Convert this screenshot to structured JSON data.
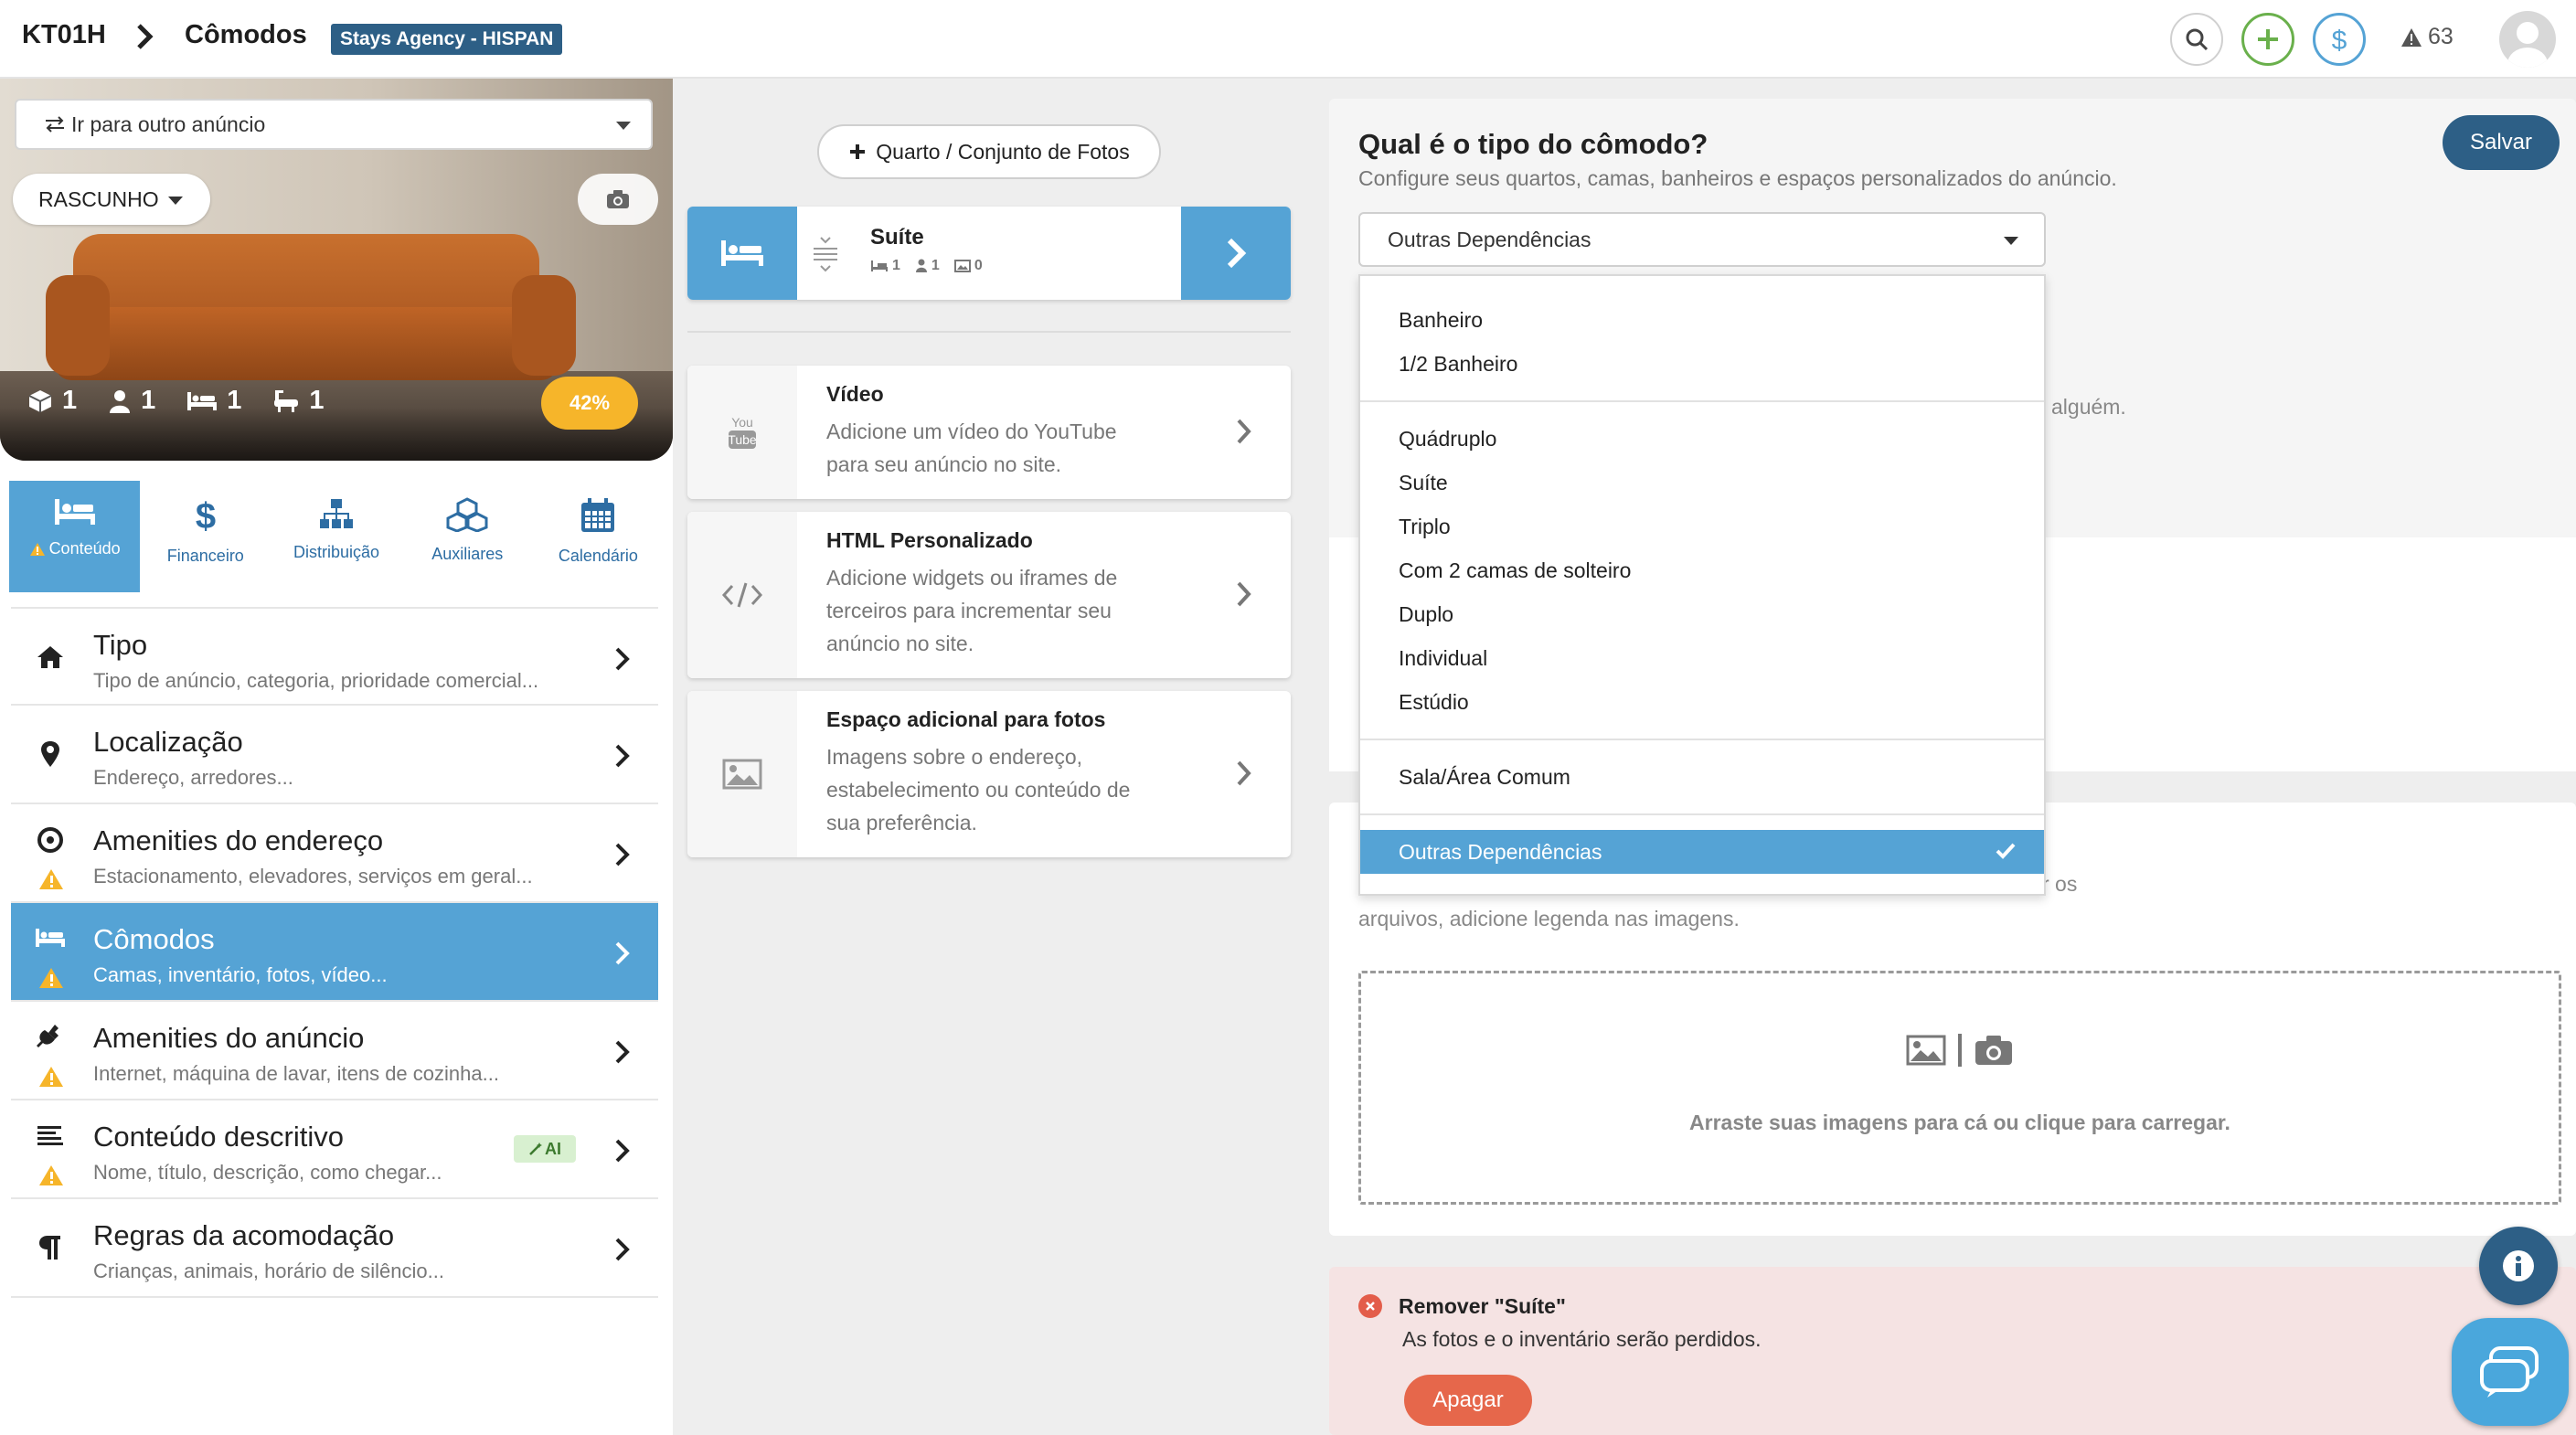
{
  "header": {
    "listing_code": "KT01H",
    "page_title": "Cômodos",
    "agency_badge": "Stays Agency - HISPAN",
    "alerts_count": "63"
  },
  "listing": {
    "goto_label": "Ir para outro anúncio",
    "status": "RASCUNHO",
    "stats": {
      "units": "1",
      "guests": "1",
      "beds": "1",
      "baths": "1"
    },
    "progress": "42%",
    "progress_value": 42
  },
  "tabs": [
    {
      "label": "Conteúdo",
      "icon": "bed-icon",
      "active": true,
      "warning": true
    },
    {
      "label": "Financeiro",
      "icon": "dollar-icon"
    },
    {
      "label": "Distribuição",
      "icon": "sitemap-icon"
    },
    {
      "label": "Auxiliares",
      "icon": "cubes-icon"
    },
    {
      "label": "Calendário",
      "icon": "calendar-icon"
    }
  ],
  "menu": [
    {
      "title": "Tipo",
      "subtitle": "Tipo de anúncio, categoria, prioridade comercial...",
      "icon": "home-icon"
    },
    {
      "title": "Localização",
      "subtitle": "Endereço, arredores...",
      "icon": "pin-icon"
    },
    {
      "title": "Amenities do endereço",
      "subtitle": "Estacionamento, elevadores, serviços em geral...",
      "icon": "target-icon",
      "warning": true
    },
    {
      "title": "Cômodos",
      "subtitle": "Camas, inventário, fotos, vídeo...",
      "icon": "bed-icon",
      "warning": true,
      "active": true
    },
    {
      "title": "Amenities do anúncio",
      "subtitle": "Internet, máquina de lavar, itens de cozinha...",
      "icon": "plug-icon",
      "warning": true
    },
    {
      "title": "Conteúdo descritivo",
      "subtitle": "Nome, título, descrição, como chegar...",
      "icon": "lines-icon",
      "warning": true,
      "badge": "AI"
    },
    {
      "title": "Regras da acomodação",
      "subtitle": "Crianças, animais, horário de silêncio...",
      "icon": "paragraph-icon"
    }
  ],
  "rooms": {
    "add_label": "Quarto / Conjunto de Fotos",
    "current": {
      "name": "Suíte",
      "beds": "1",
      "guests": "1",
      "photos": "0"
    }
  },
  "features": [
    {
      "title": "Vídeo",
      "description": "Adicione um vídeo do YouTube para seu anúncio no site.",
      "icon": "youtube-icon"
    },
    {
      "title": "HTML Personalizado",
      "description": "Adicione widgets ou iframes de terceiros para incrementar seu anúncio no site.",
      "icon": "code-icon"
    },
    {
      "title": "Espaço adicional para fotos",
      "description": "Imagens sobre o endereço, estabelecimento ou conteúdo de sua preferência.",
      "icon": "image-icon"
    }
  ],
  "room_type": {
    "question": "Qual é o tipo do cômodo?",
    "hint": "Configure seus quartos, camas, banheiros e espaços personalizados do anúncio.",
    "selected": "Outras Dependências",
    "save_label": "Salvar",
    "groups": [
      [
        "Banheiro",
        "1/2 Banheiro"
      ],
      [
        "Quádruplo",
        "Suíte",
        "Triplo",
        "Com 2 camas de solteiro",
        "Duplo",
        "Individual",
        "Estúdio"
      ],
      [
        "Sala/Área Comum"
      ],
      [
        "Outras Dependências"
      ]
    ]
  },
  "background_text": {
    "partial1": "alguém.",
    "partial2": "r os",
    "partial3": "arquivos, adicione legenda nas imagens."
  },
  "upload": {
    "hint": "Arraste suas imagens para cá ou clique para carregar."
  },
  "remove": {
    "title": "Remover \"Suíte\"",
    "message": "As fotos e o inventário serão perdidos.",
    "button": "Apagar"
  },
  "colors": {
    "primary": "#2d5f86",
    "accent": "#55a3d5",
    "warning": "#f6b52a",
    "danger": "#e6674b",
    "success": "#6ab04c"
  }
}
